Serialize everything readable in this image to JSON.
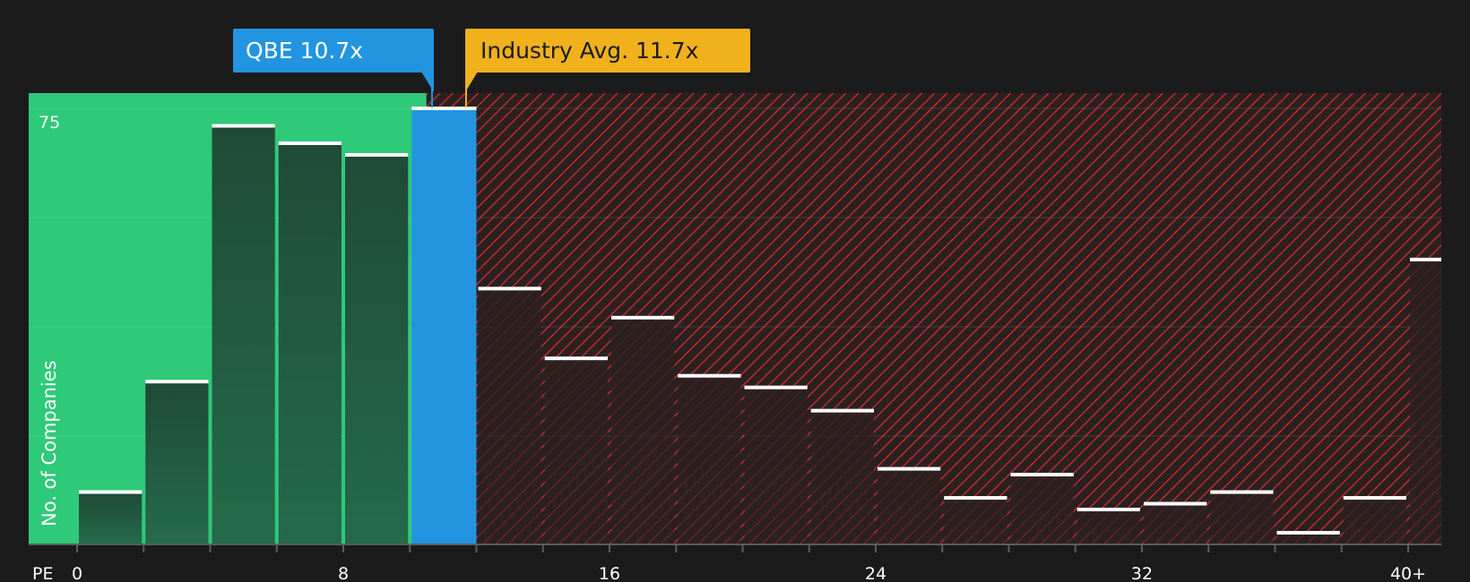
{
  "chart_data": {
    "type": "bar",
    "xlabel": "PE",
    "ylabel": "No. of Companies",
    "x_ticks": [
      "0",
      "8",
      "16",
      "24",
      "32",
      "40+"
    ],
    "x_tick_values": [
      0,
      8,
      16,
      24,
      32,
      40
    ],
    "y_ticks": [
      75
    ],
    "ylim": [
      0,
      78
    ],
    "xlim": [
      0,
      41
    ],
    "bin_width": 2,
    "bins_start": [
      0,
      2,
      4,
      6,
      8,
      10,
      12,
      14,
      16,
      18,
      20,
      22,
      24,
      26,
      28,
      30,
      32,
      34,
      36,
      38,
      40
    ],
    "values": [
      9,
      28,
      72,
      69,
      67,
      75,
      44,
      32,
      39,
      29,
      27,
      23,
      13,
      8,
      12,
      6,
      7,
      9,
      2,
      8,
      49
    ],
    "highlight_bin_index": 5,
    "company": {
      "label": "QBE 10.7x",
      "value": 10.7
    },
    "industry_avg": {
      "label": "Industry Avg. 11.7x",
      "value": 11.7
    },
    "grid": true,
    "colors": {
      "background": "#1b1b1b",
      "undervalued_zone": "#2fc97a",
      "overvalued_zone": "#c0292e",
      "bar_fill": "#1f3f30",
      "highlight_bar": "#2394e0",
      "bar_cap": "#ffffff",
      "industry_callout": "#f0b11d",
      "company_callout": "#2394e0",
      "axis": "#5c5c5c"
    }
  }
}
